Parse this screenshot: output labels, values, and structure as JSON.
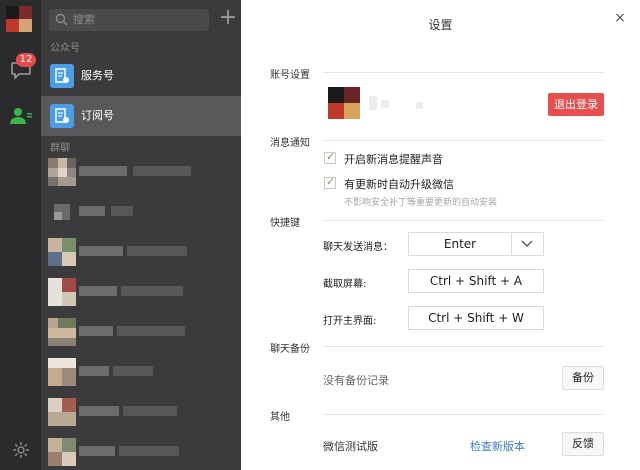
{
  "rail": {
    "unread_badge": "12"
  },
  "list": {
    "search_placeholder": "搜索",
    "add_symbol": "+",
    "official_section": "公众号",
    "official_items": [
      {
        "label": "服务号",
        "icon": "service-account-icon"
      },
      {
        "label": "订阅号",
        "icon": "subscription-account-icon"
      }
    ],
    "group_section": "群聊",
    "groups_count_visible": 9
  },
  "dialog": {
    "title": "设置",
    "close_symbol": "×",
    "account": {
      "section": "账号设置",
      "logout_label": "退出登录"
    },
    "notify": {
      "section": "消息通知",
      "option1": "开启新消息提醒声音",
      "option2": "有更新时自动升级微信",
      "hint": "不影响安全补丁等重要更新的自动安装"
    },
    "shortcuts": {
      "section": "快捷键",
      "send_label": "聊天发送消息：",
      "send_value": "Enter",
      "capture_label": "截取屏幕:",
      "capture_value": "Ctrl + Shift + A",
      "open_label": "打开主界面:",
      "open_value": "Ctrl + Shift + W"
    },
    "backup": {
      "section": "聊天备份",
      "empty_text": "没有备份记录",
      "button_label": "备份"
    },
    "other": {
      "section": "其他",
      "version_text": "微信测试版",
      "update_link": "检查新版本",
      "feedback_label": "反馈"
    }
  },
  "colors": {
    "accent_blue": "#4a9ee6",
    "danger_red": "#e84e4e",
    "link_blue": "#3d7ec7",
    "rail_bg": "#2b2b2d",
    "list_bg": "#3b3b3d"
  }
}
